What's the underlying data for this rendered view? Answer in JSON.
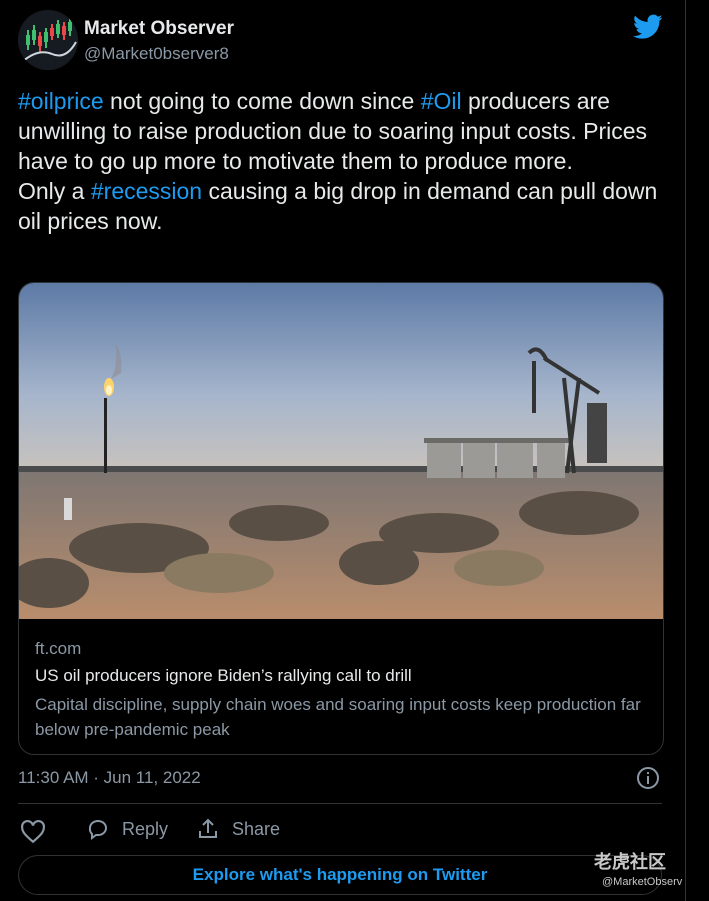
{
  "author": {
    "name": "Market Observer",
    "handle": "@Market0bserver8"
  },
  "tweet": {
    "segments_line1": [
      {
        "text": "#oilprice",
        "tag": true
      },
      {
        "text": " not going to come down since ",
        "tag": false
      },
      {
        "text": "#Oil",
        "tag": true
      },
      {
        "text": " producers are unwilling to raise production due to soaring input costs. Prices have to go up more to motivate them to produce more.",
        "tag": false
      }
    ],
    "segments_line2": [
      {
        "text": "Only a ",
        "tag": false
      },
      {
        "text": "#recession",
        "tag": true
      },
      {
        "text": " causing a big drop in demand can pull down oil prices now.",
        "tag": false
      }
    ]
  },
  "card": {
    "domain": "ft.com",
    "title": "US oil producers ignore Biden’s rallying call to drill",
    "description": "Capital discipline, supply chain woes and soaring input costs keep production far below pre-pandemic peak"
  },
  "timestamp": "11:30 AM · Jun 11, 2022",
  "actions": {
    "reply": "Reply",
    "share": "Share"
  },
  "explore": "Explore what's happening on Twitter",
  "watermark": {
    "logo": "老虎社区",
    "handle": "@MarketObserv"
  },
  "colors": {
    "accent": "#1d9bf0",
    "background": "#000000",
    "muted": "#8b98a5",
    "text": "#e7e9ea"
  },
  "icons": [
    "twitter-bird-icon",
    "info-icon",
    "heart-icon",
    "reply-icon",
    "share-icon"
  ]
}
